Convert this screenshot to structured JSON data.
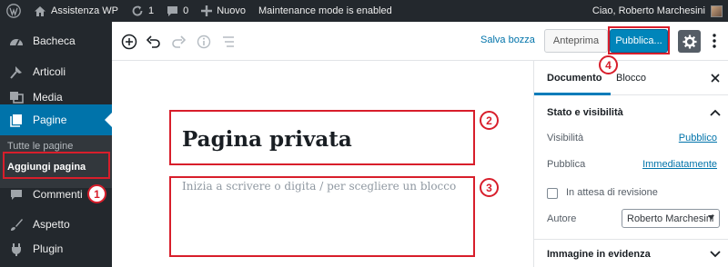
{
  "admin_bar": {
    "site_name": "Assistenza WP",
    "updates_count": "1",
    "comments_count": "0",
    "new_label": "Nuovo",
    "maintenance_notice": "Maintenance mode is enabled",
    "greeting": "Ciao, Roberto Marchesini"
  },
  "sidebar": {
    "items": [
      {
        "label": "Bacheca",
        "icon": "dashboard-icon"
      },
      {
        "label": "Articoli",
        "icon": "pushpin-icon"
      },
      {
        "label": "Media",
        "icon": "media-icon"
      },
      {
        "label": "Pagine",
        "icon": "pages-icon"
      },
      {
        "label": "Commenti",
        "icon": "comments-icon"
      },
      {
        "label": "Aspetto",
        "icon": "appearance-icon"
      },
      {
        "label": "Plugin",
        "icon": "plugin-icon"
      }
    ],
    "submenu": [
      "Tutte le pagine",
      "Aggiungi pagina"
    ]
  },
  "toolbar": {
    "save_draft": "Salva bozza",
    "preview": "Anteprima",
    "publish": "Pubblica..."
  },
  "editor": {
    "title": "Pagina privata",
    "placeholder": "Inizia a scrivere o digita / per scegliere un blocco"
  },
  "panel": {
    "tabs": [
      "Documento",
      "Blocco"
    ],
    "status_section": "Stato e visibilità",
    "visibility_label": "Visibilità",
    "visibility_value": "Pubblico",
    "publish_label": "Pubblica",
    "publish_value": "Immediatamente",
    "pending_review": "In attesa di revisione",
    "author_label": "Autore",
    "author_value": "Roberto Marchesini",
    "featured_image_section": "Immagine in evidenza"
  },
  "annotations": [
    "1",
    "2",
    "3",
    "4"
  ],
  "colors": {
    "admin_bg": "#23282d",
    "accent": "#0073aa",
    "publish_button": "#0085ba",
    "annotation": "#d81e2b"
  }
}
